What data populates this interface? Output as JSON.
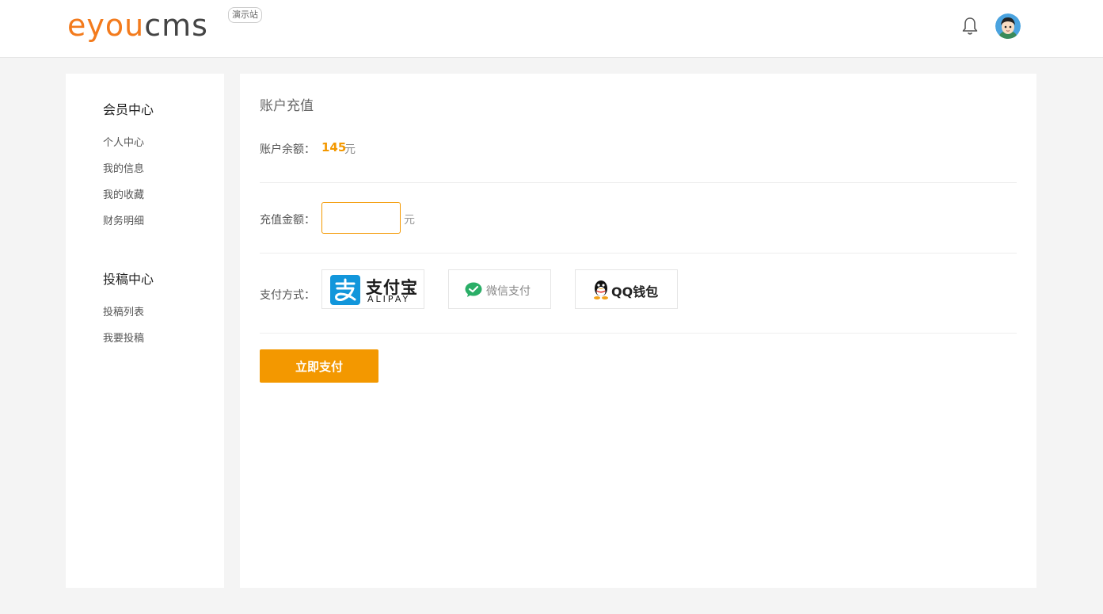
{
  "header": {
    "logo": {
      "part1": "eyou",
      "part2": "cms"
    },
    "demo_badge": "演示站"
  },
  "sidebar": {
    "groups": [
      {
        "title": "会员中心",
        "items": [
          "个人中心",
          "我的信息",
          "我的收藏",
          "财务明细"
        ]
      },
      {
        "title": "投稿中心",
        "items": [
          "投稿列表",
          "我要投稿"
        ]
      }
    ]
  },
  "main": {
    "title": "账户充值",
    "balance_label": "账户余额：",
    "balance_value": "145",
    "balance_unit": "元",
    "amount_label": "充值金额：",
    "amount_value": "",
    "amount_unit": "元",
    "payment_label": "支付方式：",
    "payment_options": {
      "alipay_main": "支付宝",
      "alipay_sub": "ALIPAY",
      "wechat": "微信支付",
      "qq": "QQ钱包"
    },
    "pay_button": "立即支付"
  },
  "colors": {
    "accent": "#f39800",
    "logo_orange": "#f37b1d",
    "alipay_blue": "#1296db",
    "wechat_green": "#2aae67"
  },
  "icons": {
    "bell": "bell-icon",
    "avatar": "avatar",
    "alipay": "alipay-icon",
    "wechat": "wechat-icon",
    "qq": "qq-penguin-icon"
  }
}
